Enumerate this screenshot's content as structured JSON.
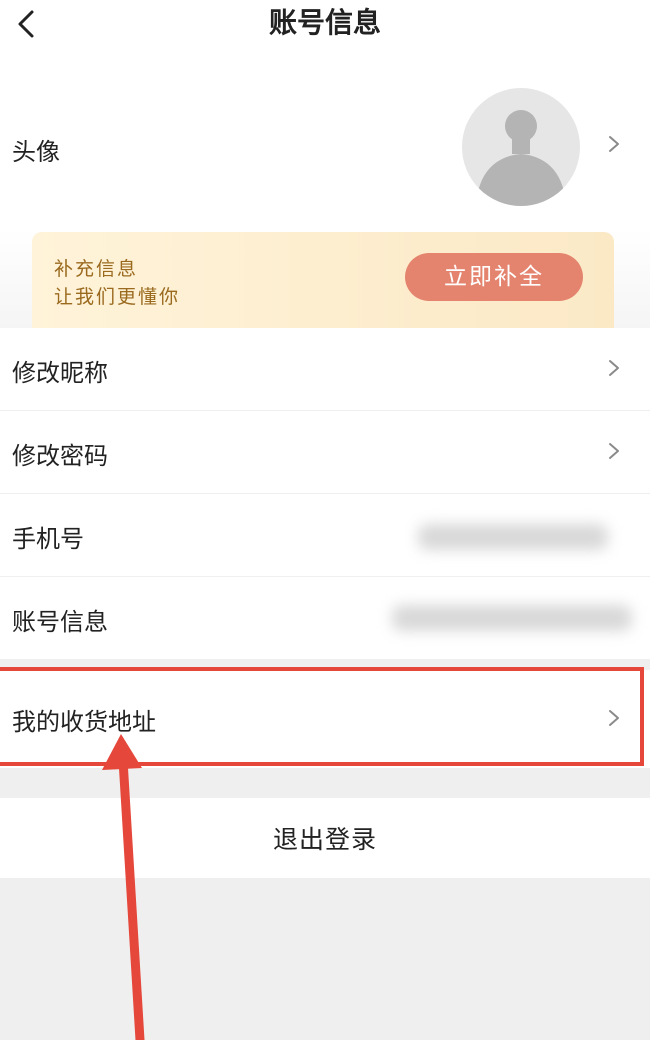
{
  "header": {
    "title": "账号信息",
    "back_icon": "chevron-left-icon"
  },
  "avatar_row": {
    "label": "头像"
  },
  "promo_banner": {
    "line1": "补充信息",
    "line2": "让我们更懂你",
    "button_label": "立即补全",
    "colors": {
      "background": "#fff3d9",
      "text": "#9a6a1e",
      "button": "#e4846e"
    }
  },
  "menu": {
    "items": [
      {
        "label": "修改昵称"
      },
      {
        "label": "修改密码"
      },
      {
        "label": "手机号"
      },
      {
        "label": "账号信息"
      }
    ]
  },
  "address": {
    "label": "我的收货地址",
    "highlight_color": "#e5473a"
  },
  "logout": {
    "label": "退出登录"
  }
}
